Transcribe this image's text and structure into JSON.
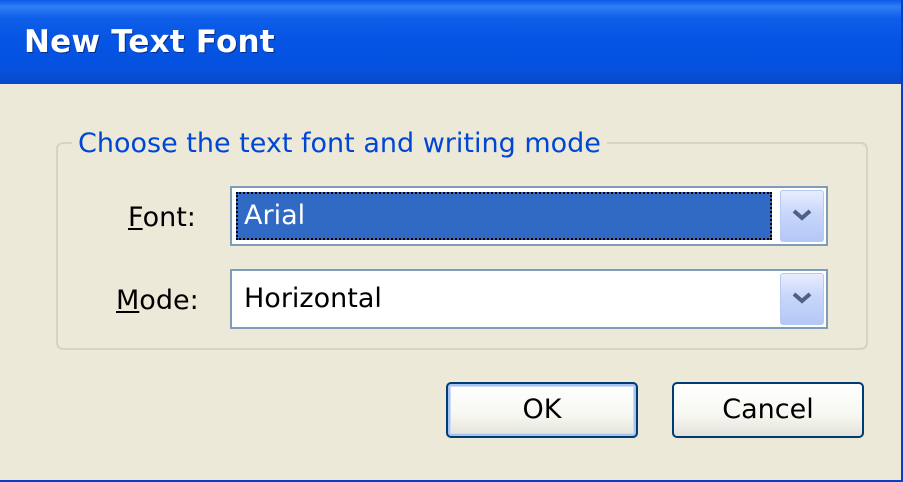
{
  "dialog": {
    "title": "New Text Font"
  },
  "group": {
    "legend": "Choose the text font and writing mode"
  },
  "font_field": {
    "label_mnemonic": "F",
    "label_rest": "ont:",
    "value": "Arial"
  },
  "mode_field": {
    "label_mnemonic": "M",
    "label_rest": "ode:",
    "value": "Horizontal"
  },
  "buttons": {
    "ok_label": "OK",
    "cancel_label": "Cancel"
  },
  "icons": {
    "dropdown": "chevron-down-icon"
  },
  "colors": {
    "titlebar": "#0554e3",
    "window_bg": "#ece9d8",
    "legend_text": "#0046d5",
    "selection": "#316ac5"
  }
}
